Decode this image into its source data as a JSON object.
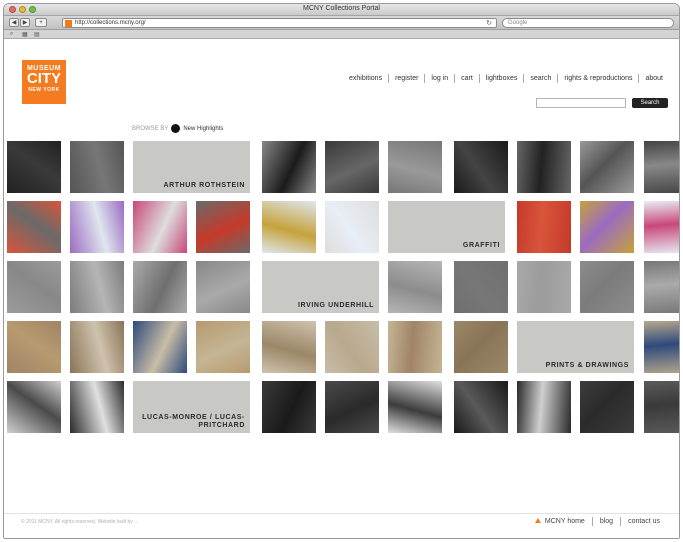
{
  "window": {
    "title": "MCNY Collections Portal",
    "url": "http://collections.mcny.org/",
    "search_placeholder": "Google",
    "bookmarks": [
      "⌕",
      "▦",
      "▤"
    ]
  },
  "logo": {
    "line1": "MUSEUM",
    "line2": "CITY",
    "line3": "NEW YORK",
    "prefix": "of the"
  },
  "nav": {
    "items": [
      "exhibitions",
      "register",
      "log in",
      "cart",
      "lightboxes",
      "search",
      "rights & reproductions",
      "about"
    ]
  },
  "site_search": {
    "placeholder": "",
    "button": "Search"
  },
  "browse": {
    "label": "BROWSE BY",
    "selected": "New Highlights"
  },
  "gallery": {
    "labels": [
      {
        "name": "arthur-rothstein",
        "text": "ARTHUR ROTHSTEIN"
      },
      {
        "name": "graffiti",
        "text": "GRAFFITI"
      },
      {
        "name": "irving-underhill",
        "text": "IRVING UNDERHILL"
      },
      {
        "name": "prints-drawings",
        "text": "PRINTS & DRAWINGS"
      },
      {
        "name": "lucas-monroe",
        "text": "LUCAS-MONROE / LUCAS-PRITCHARD"
      }
    ]
  },
  "footer": {
    "copyright": "© 2011 MCNY. All rights reserved. Website built by ...",
    "links": [
      "MCNY home",
      "blog",
      "contact us"
    ]
  },
  "colors": {
    "accent": "#f47b20",
    "label_tile": "#c8c8c4"
  }
}
